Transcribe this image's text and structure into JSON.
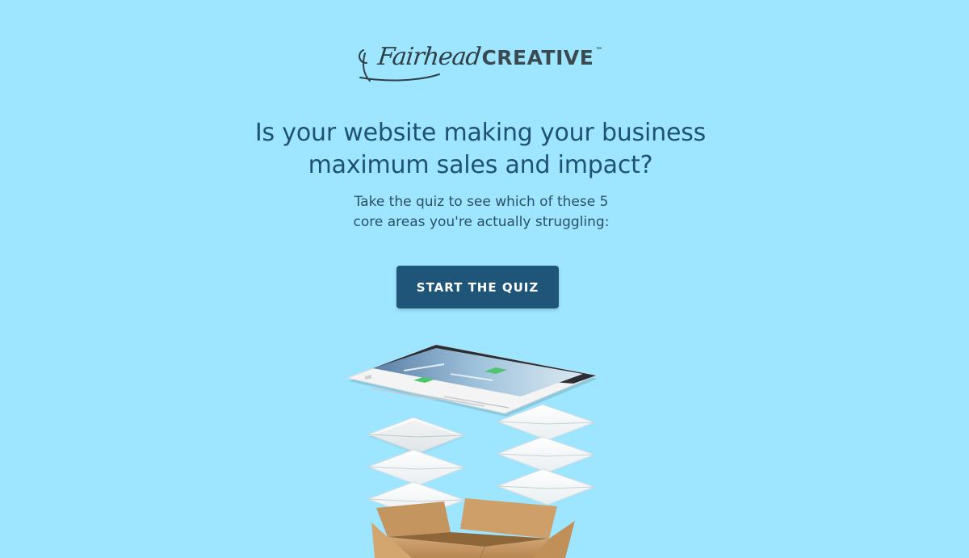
{
  "logo": {
    "script": "Fairhead",
    "word": "CREATIVE",
    "tm": "™"
  },
  "hero": {
    "headline_line1": "Is your website making your business",
    "headline_line2": "maximum sales and impact?",
    "subhead_line1": "Take the quiz to see which of these 5",
    "subhead_line2": "core areas you're actually struggling:"
  },
  "cta": {
    "label": "START THE QUIZ"
  },
  "colors": {
    "background": "#9ee6ff",
    "headline": "#1f5270",
    "button": "#1f5578",
    "button_text": "#ffffff",
    "box": "#c89a66"
  },
  "illustration": {
    "icons": [
      "laptop-screen-icon",
      "envelope-icon",
      "cardboard-box-icon"
    ]
  }
}
